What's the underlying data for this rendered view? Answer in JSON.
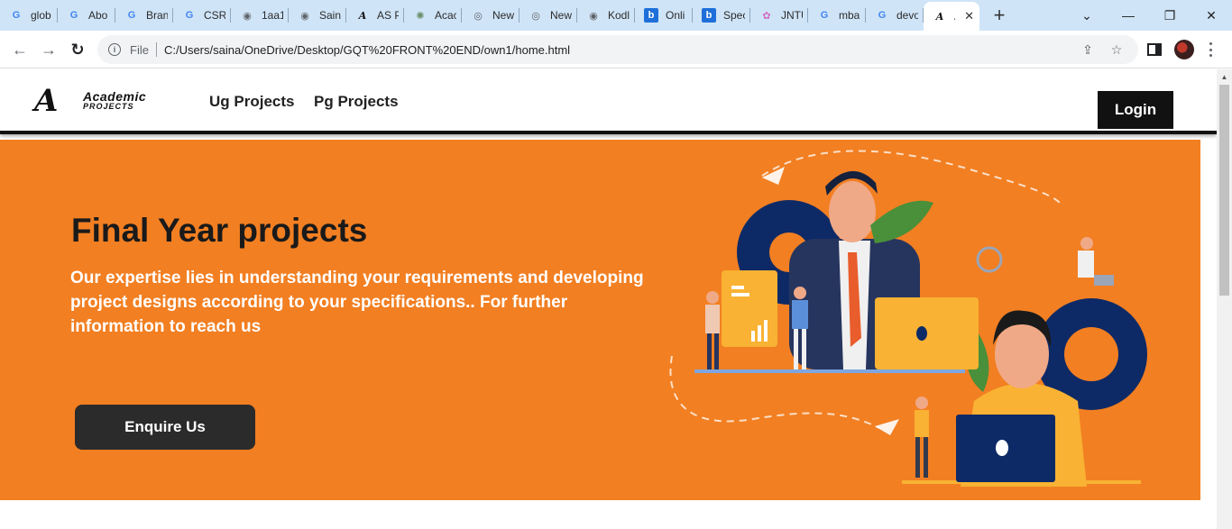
{
  "browser": {
    "tabs": [
      {
        "label": "glob",
        "icon": "google-icon"
      },
      {
        "label": "Abo",
        "icon": "google-icon"
      },
      {
        "label": "Bran",
        "icon": "google-icon"
      },
      {
        "label": "CSR",
        "icon": "google-icon"
      },
      {
        "label": "1aa1",
        "icon": "globe-icon"
      },
      {
        "label": "Sain",
        "icon": "globe-icon"
      },
      {
        "label": "AS P",
        "icon": "academic-logo-icon"
      },
      {
        "label": "Acac",
        "icon": "openai-icon"
      },
      {
        "label": "New",
        "icon": "chrome-icon"
      },
      {
        "label": "New",
        "icon": "chrome-icon"
      },
      {
        "label": "Kodl",
        "icon": "globe-icon"
      },
      {
        "label": "Onli",
        "icon": "b-icon"
      },
      {
        "label": "Spec",
        "icon": "b-icon"
      },
      {
        "label": "JNTU",
        "icon": "flower-icon"
      },
      {
        "label": "mba",
        "icon": "google-icon"
      },
      {
        "label": "devo",
        "icon": "google-icon"
      }
    ],
    "active_tab": {
      "label": "A",
      "icon": "academic-logo-icon"
    },
    "address": {
      "scheme": "File",
      "url": "C:/Users/saina/OneDrive/Desktop/GQT%20FRONT%20END/own1/home.html"
    }
  },
  "site": {
    "logo": {
      "word1": "Academic",
      "word2": "PROJECTS"
    },
    "nav": {
      "ug": "Ug Projects",
      "pg": "Pg Projects",
      "login": "Login"
    },
    "hero": {
      "title": "Final Year projects",
      "text": "Our expertise lies in understanding your requirements and developing project designs according to your specifications.. For further information to reach us",
      "button": "Enquire Us"
    }
  },
  "colors": {
    "accent": "#f27f22",
    "dark": "#111111",
    "button": "#2b2b2b"
  }
}
